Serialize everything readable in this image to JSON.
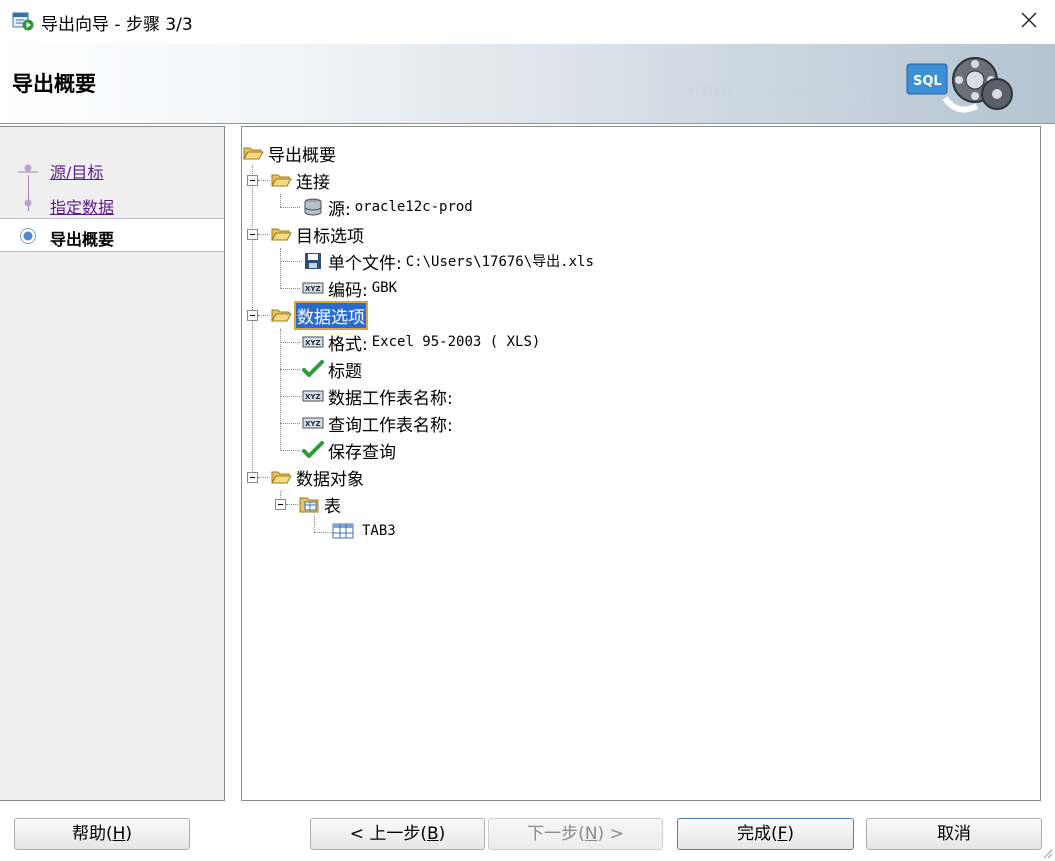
{
  "window": {
    "title": "导出向导 - 步骤 3/3"
  },
  "header": {
    "title": "导出概要",
    "binary_a": "01010101010101010101010101",
    "binary_b": "0101010101"
  },
  "steps": [
    {
      "label": "源/目标",
      "state": "done"
    },
    {
      "label": "指定数据",
      "state": "done"
    },
    {
      "label": "导出概要",
      "state": "current"
    }
  ],
  "tree": {
    "root": "导出概要",
    "connection": {
      "label": "连接",
      "source_label": "源:",
      "source_value": "oracle12c-prod"
    },
    "target": {
      "label": "目标选项",
      "file_label": "单个文件:",
      "file_value": "C:\\Users\\17676\\导出.xls",
      "encoding_label": "编码:",
      "encoding_value": "GBK"
    },
    "data_options": {
      "label": "数据选项",
      "format_label": "格式:",
      "format_value": "Excel 95-2003 ( XLS)",
      "title_label": "标题",
      "data_sheet_label": "数据工作表名称:",
      "query_sheet_label": "查询工作表名称:",
      "save_query_label": "保存查询"
    },
    "data_objects": {
      "label": "数据对象",
      "tables_label": "表",
      "table_name": "TAB3"
    }
  },
  "buttons": {
    "help": {
      "text": "帮助(",
      "key": "H",
      "close": ")"
    },
    "back": {
      "text": "< 上一步(",
      "key": "B",
      "close": ")"
    },
    "next": {
      "text": "下一步(",
      "key": "N",
      "close": ") >"
    },
    "finish": {
      "text": "完成(",
      "key": "F",
      "close": ")"
    },
    "cancel": {
      "text": "取消"
    }
  }
}
